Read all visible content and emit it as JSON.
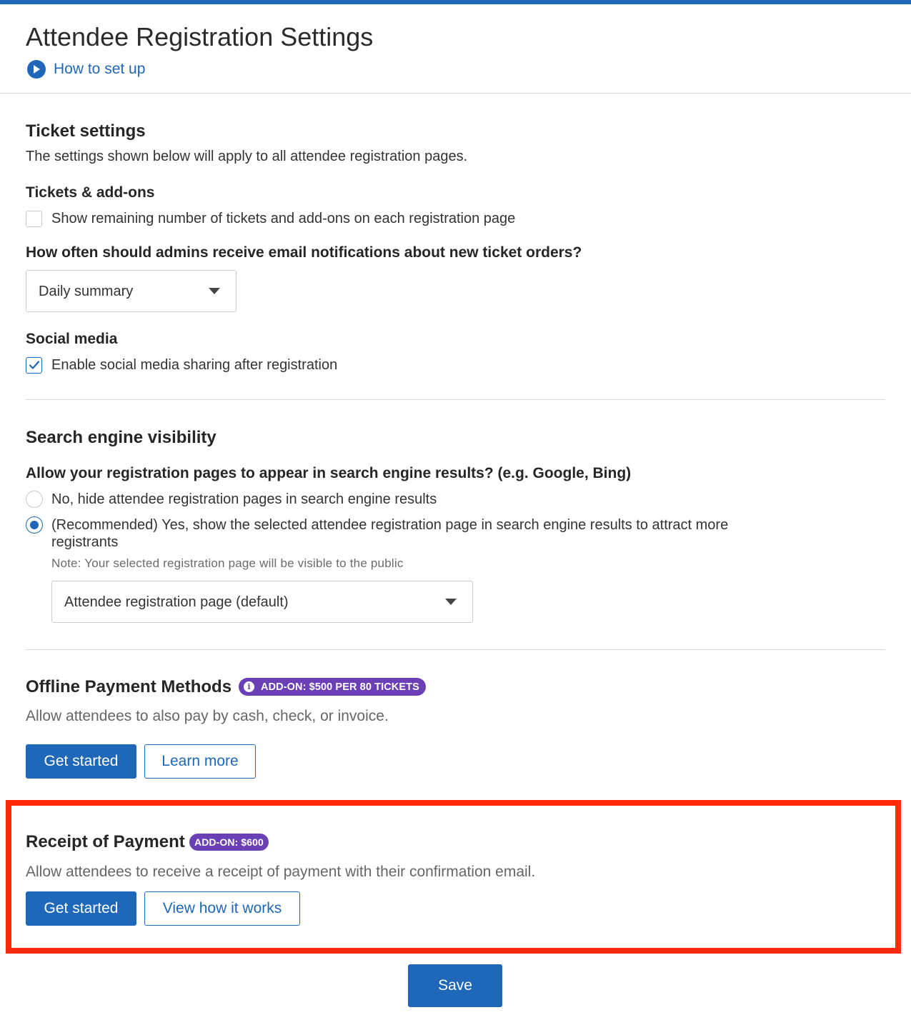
{
  "header": {
    "title": "Attendee Registration Settings",
    "how_to": "How to set up"
  },
  "ticket_settings": {
    "title": "Ticket settings",
    "description": "The settings shown below will apply to all attendee registration pages.",
    "tickets_addons": {
      "label": "Tickets & add-ons",
      "checkbox_label": "Show remaining number of tickets and add-ons on each registration page",
      "checked": false
    },
    "notifications": {
      "question": "How often should admins receive email notifications about new ticket orders?",
      "selected": "Daily summary"
    },
    "social_media": {
      "label": "Social media",
      "checkbox_label": "Enable social media sharing after registration",
      "checked": true
    }
  },
  "search_engine": {
    "title": "Search engine visibility",
    "question": "Allow your registration pages to appear in search engine results? (e.g. Google, Bing)",
    "options": [
      {
        "label": "No, hide attendee registration pages in search engine results",
        "selected": false
      },
      {
        "label": "(Recommended) Yes, show the selected attendee registration page in search engine results to attract more registrants",
        "selected": true
      }
    ],
    "note": "Note: Your selected registration page will be visible to the public",
    "page_select": "Attendee registration page (default)"
  },
  "offline_payment": {
    "title": "Offline Payment Methods",
    "badge": "ADD-ON: $500 PER 80 TICKETS",
    "description": "Allow attendees to also pay by cash, check, or invoice.",
    "primary_button": "Get started",
    "secondary_button": "Learn more"
  },
  "receipt_payment": {
    "title": "Receipt of Payment",
    "badge": "ADD-ON: $600",
    "description": "Allow attendees to receive a receipt of payment with their confirmation email.",
    "primary_button": "Get started",
    "secondary_button": "View how it works"
  },
  "footer": {
    "save": "Save"
  },
  "colors": {
    "primary": "#1f67b8",
    "badge": "#6b3fb5",
    "highlight": "#ff2a0c"
  }
}
